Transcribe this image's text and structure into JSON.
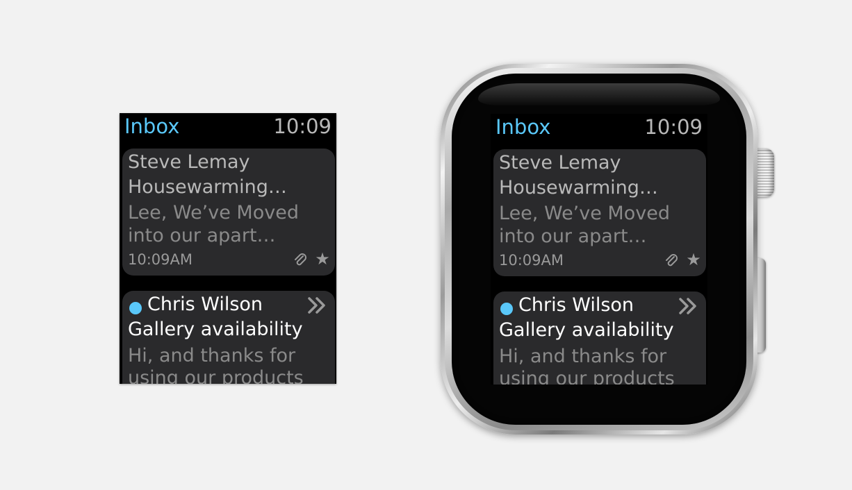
{
  "colors": {
    "accent": "#5ac8fa",
    "card_background": "#2a2a2c",
    "screen_background": "#000000",
    "page_background": "#f2f2f2"
  },
  "screen": {
    "header": {
      "title": "Inbox",
      "time": "10:09"
    },
    "messages": [
      {
        "sender": "Steve Lemay",
        "subject": "Housewarming…",
        "preview": "Lee, We’ve Moved into our apart…",
        "time": "10:09AM",
        "unread": false,
        "icons": [
          "paperclip-icon",
          "star-icon"
        ]
      },
      {
        "sender": "Chris Wilson",
        "subject": "Gallery availability",
        "preview": "Hi, and thanks for using our products",
        "unread": true,
        "icons": [
          "unread-dot-icon",
          "double-chevron-icon"
        ]
      }
    ]
  }
}
